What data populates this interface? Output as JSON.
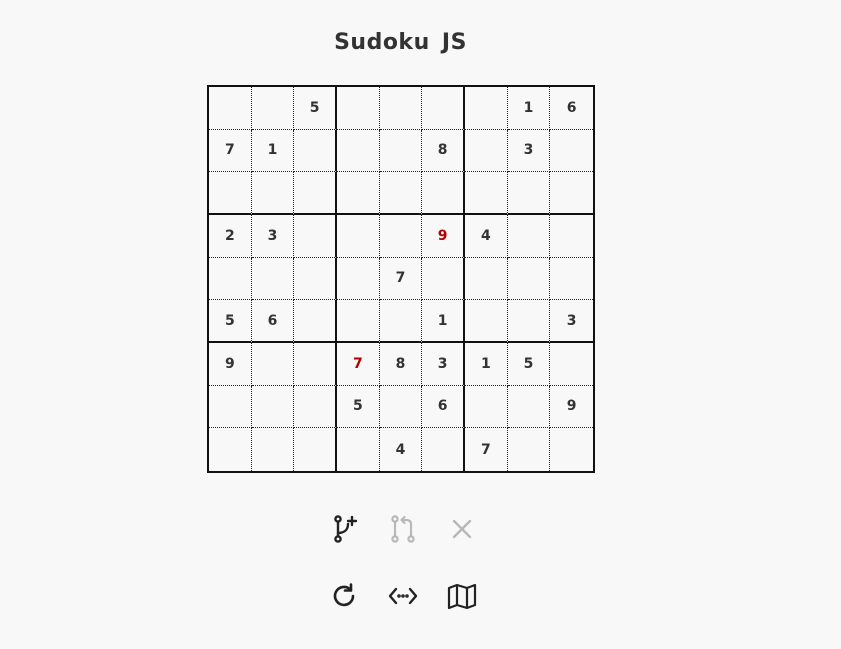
{
  "title": "Sudoku  JS",
  "board": {
    "cells": [
      [
        "",
        "",
        "5",
        "",
        "",
        "",
        "",
        "1",
        "6"
      ],
      [
        "7",
        "1",
        "",
        "",
        "",
        "8",
        "",
        "3",
        ""
      ],
      [
        "",
        "",
        "",
        "",
        "",
        "",
        "",
        "",
        ""
      ],
      [
        "2",
        "3",
        "",
        "",
        "",
        "9",
        "4",
        "",
        ""
      ],
      [
        "",
        "",
        "",
        "",
        "7",
        "",
        "",
        "",
        ""
      ],
      [
        "5",
        "6",
        "",
        "",
        "",
        "1",
        "",
        "",
        "3"
      ],
      [
        "9",
        "",
        "",
        "7",
        "8",
        "3",
        "1",
        "5",
        ""
      ],
      [
        "",
        "",
        "",
        "5",
        "",
        "6",
        "",
        "",
        "9"
      ],
      [
        "",
        "",
        "",
        "",
        "4",
        "",
        "7",
        "",
        ""
      ]
    ],
    "conflicts": [
      [
        3,
        5
      ],
      [
        6,
        3
      ]
    ]
  },
  "controls": {
    "row1": [
      {
        "icon": "git-branch-plus-icon",
        "name": "branch-button",
        "enabled": true
      },
      {
        "icon": "git-pull-request-icon",
        "name": "merge-button",
        "enabled": false
      },
      {
        "icon": "close-icon",
        "name": "discard-button",
        "enabled": false
      }
    ],
    "row2": [
      {
        "icon": "refresh-icon",
        "name": "restart-button",
        "enabled": true
      },
      {
        "icon": "code-icon",
        "name": "share-button",
        "enabled": true
      },
      {
        "icon": "map-icon",
        "name": "map-button",
        "enabled": true
      }
    ]
  },
  "colors": {
    "text": "#333333",
    "conflict": "#b00000",
    "disabled_icon": "#b8b8b8",
    "background": "#f8f8f8"
  }
}
